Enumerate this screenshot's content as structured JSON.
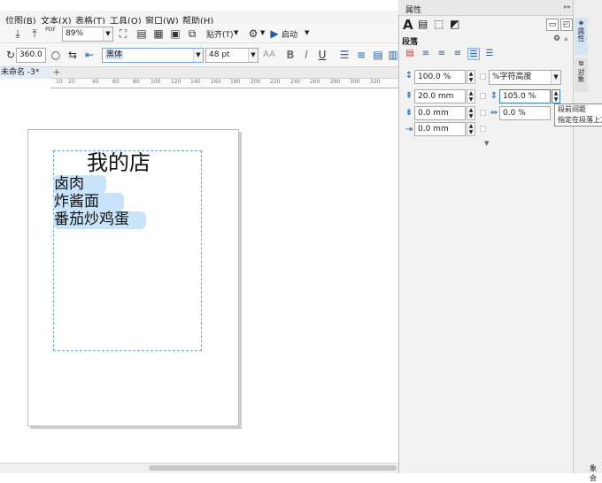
{
  "menubar": {
    "items": [
      "位图(B)",
      "文本(X)",
      "表格(T)",
      "工具(O)",
      "窗口(W)",
      "帮助(H)"
    ]
  },
  "toolbar1": {
    "zoom": "89%",
    "snap_label": "贴齐(T)",
    "launch_label": "启动",
    "pdf_label": "PDF"
  },
  "toolbar2": {
    "rotation": "360.0",
    "font_name": "黑体",
    "font_size": "48 pt",
    "bold": "B",
    "italic": "I",
    "underline": "U"
  },
  "tabbar": {
    "doc_tab": "未命名 -3*",
    "add_tab": "+"
  },
  "ruler": {
    "labels": [
      "10",
      "20",
      "40",
      "60",
      "80",
      "100",
      "120",
      "140",
      "160",
      "180",
      "200",
      "220",
      "240",
      "260",
      "280",
      "300",
      "320"
    ]
  },
  "canvas": {
    "title": "我的店",
    "lines": [
      "卤肉",
      "炸酱面",
      "番茄炒鸡蛋"
    ]
  },
  "panel": {
    "title": "属性",
    "section": "段落",
    "line_spacing": "100.0 %",
    "spacing_unit": "%字符高度",
    "before_paragraph": "20.0 mm",
    "paragraph_spacing": "105.0 %",
    "after_paragraph": "0.0 mm",
    "char_spacing": "0.0 %",
    "indent": "0.0 mm"
  },
  "tooltip": {
    "title": "段前间距",
    "desc": "指定在段落上方"
  },
  "right_tabs": {
    "props": "属性",
    "objects": "对象"
  },
  "statusbar": {
    "right_text": "象会"
  },
  "colors": {
    "accent": "#1f5fa8",
    "highlight": "#c8e3fa",
    "frame": "#6aa6d8"
  }
}
